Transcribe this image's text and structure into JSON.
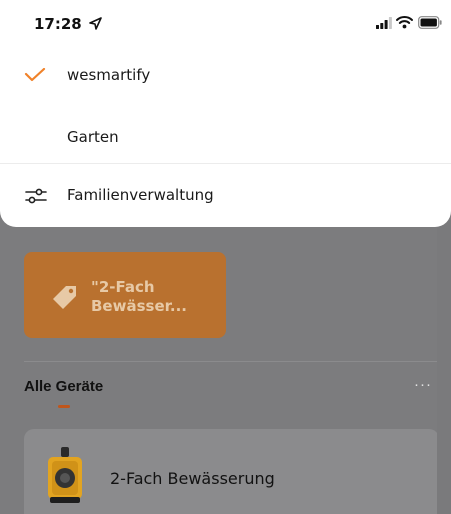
{
  "status_bar": {
    "time": "17:28",
    "icons": [
      "location-arrow-icon",
      "signal-icon",
      "wifi-icon",
      "battery-icon"
    ]
  },
  "home_menu": {
    "items": [
      {
        "label": "wesmartify",
        "selected": true
      },
      {
        "label": "Garten",
        "selected": false
      }
    ],
    "manage_label": "Familienverwaltung"
  },
  "background": {
    "scene_card": {
      "label": "\"2-Fach\nBewässer..."
    },
    "devices_section": {
      "title": "Alle Geräte",
      "more": "···"
    },
    "devices": [
      {
        "name": "2-Fach Bewässerung"
      }
    ]
  },
  "colors": {
    "accent": "#f0822a",
    "overlay": "#7c7c7e",
    "scene_card": "#b9712f",
    "sheet": "#ffffff"
  }
}
